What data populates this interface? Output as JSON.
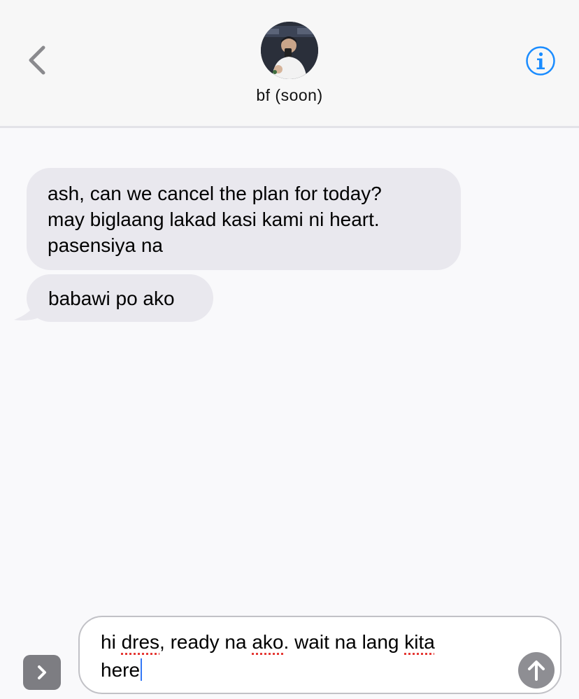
{
  "header": {
    "contact_name": "bf (soon)",
    "back_icon": "chevron-left-icon",
    "info_icon": "info-icon",
    "accent_color": "#1a8cff"
  },
  "messages": [
    {
      "direction": "incoming",
      "lines": [
        "ash, can we cancel the plan for today?",
        "may biglaang lakad kasi kami ni heart.",
        "pasensiya na"
      ]
    },
    {
      "direction": "incoming",
      "text": "babawi po ako"
    }
  ],
  "composer": {
    "apps_icon": "chevron-right-icon",
    "send_icon": "arrow-up-icon",
    "text_segments": {
      "s1": "hi ",
      "s2": "dres",
      "s3": ", ready na ",
      "s4": "ako",
      "s5": ". wait na lang ",
      "s6": "kita",
      "s7": "here"
    },
    "misspelled_words": [
      "dres",
      "ako",
      "kita"
    ]
  },
  "colors": {
    "incoming_bubble": "#e9e8ee",
    "send_button": "#8e8e93",
    "spellcheck_underline": "#e53935",
    "caret": "#3478f6"
  }
}
